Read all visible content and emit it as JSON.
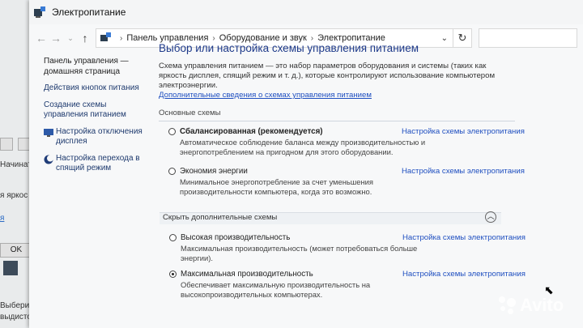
{
  "window": {
    "title": "Электропитание"
  },
  "breadcrumb": [
    "Панель управления",
    "Оборудование и звук",
    "Электропитание"
  ],
  "sidebar": {
    "items": [
      {
        "label": "Панель управления — домашняя страница"
      },
      {
        "label": "Действия кнопок питания"
      },
      {
        "label": "Создание схемы управления питанием"
      },
      {
        "label": "Настройка отключения дисплея"
      },
      {
        "label": "Настройка перехода в спящий режим"
      }
    ]
  },
  "main": {
    "heading": "Выбор или настройка схемы управления питанием",
    "description": "Схема управления питанием — это набор параметров оборудования и системы (таких как яркость дисплея, спящий режим и т. д.), которые контролируют использование компьютером электроэнергии.",
    "more_link": "Дополнительные сведения о схемах управления питанием",
    "basic_section": "Основные схемы",
    "plans": [
      {
        "name": "Сбалансированная (рекомендуется)",
        "desc": "Автоматическое соблюдение баланса между производительностью и энергопотреблением на пригодном для этого оборудовании.",
        "link": "Настройка схемы электропитания",
        "selected": false
      },
      {
        "name": "Экономия энергии",
        "desc": "Минимальное энергопотребление за счет уменьшения производительности компьютера, когда это возможно.",
        "link": "Настройка схемы электропитания",
        "selected": false
      }
    ],
    "hide_section": "Скрыть дополнительные схемы",
    "extra_plans": [
      {
        "name": "Высокая производительность",
        "desc": "Максимальная производительность (может потребоваться больше энергии).",
        "link": "Настройка схемы электропитания",
        "selected": false
      },
      {
        "name": "Максимальная производительность",
        "desc": "Обеспечивает максимальную производительность на высокопроизводительных компьютерах.",
        "link": "Настройка схемы электропитания",
        "selected": true
      }
    ]
  },
  "background_window": {
    "fragments": [
      "Начинать",
      "я яркос",
      "Выберите",
      "выдисто"
    ],
    "ok": "OK",
    "link_fragment": "я"
  },
  "watermark": "Avito"
}
